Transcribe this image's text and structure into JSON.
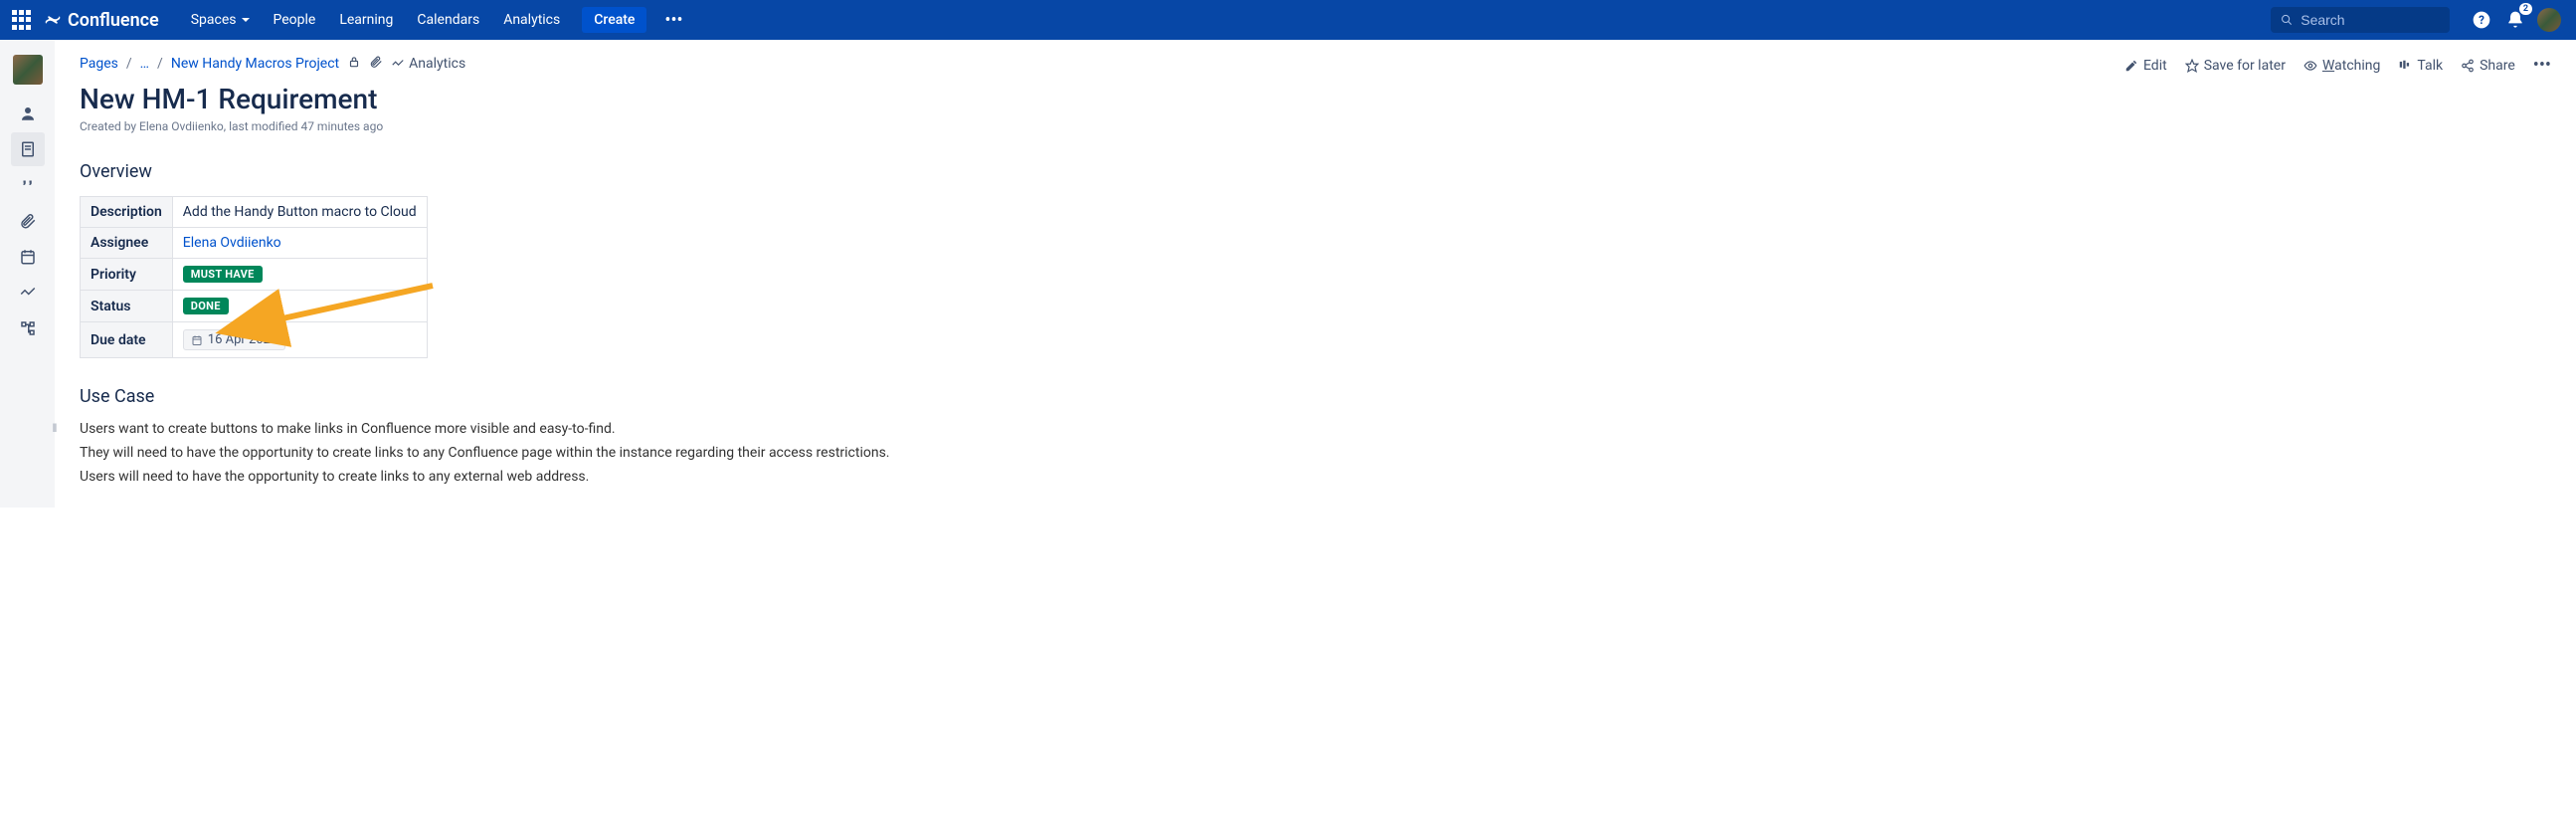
{
  "nav": {
    "brand": "Confluence",
    "items": [
      "Spaces",
      "People",
      "Learning",
      "Calendars",
      "Analytics"
    ],
    "create": "Create",
    "search_placeholder": "Search",
    "notif_count": "2"
  },
  "breadcrumbs": {
    "root": "Pages",
    "ellipsis": "…",
    "space": "New Handy Macros Project",
    "analytics": "Analytics"
  },
  "toolbar": {
    "edit": "Edit",
    "save": "Save for later",
    "watch_prefix": "W",
    "watch_rest": "atching",
    "talk": "Talk",
    "share": "Share"
  },
  "page": {
    "title": "New HM-1 Requirement",
    "byline": "Created by Elena Ovdiienko, last modified 47 minutes ago"
  },
  "sections": {
    "overview": "Overview",
    "usecase": "Use Case"
  },
  "table": {
    "rows": {
      "description": {
        "label": "Description",
        "value": "Add the Handy Button macro to Cloud"
      },
      "assignee": {
        "label": "Assignee",
        "value": "Elena Ovdiienko"
      },
      "priority": {
        "label": "Priority",
        "value": "MUST HAVE"
      },
      "status": {
        "label": "Status",
        "value": "DONE"
      },
      "duedate": {
        "label": "Due date",
        "value": "16 Apr 2022"
      }
    }
  },
  "usecase_paras": [
    "Users want to create buttons to make links in Confluence more visible and easy-to-find.",
    "They will need to have the opportunity to create links to any Confluence page within the instance regarding their access restrictions.",
    "Users will need to have the opportunity to create links to any external web address."
  ]
}
